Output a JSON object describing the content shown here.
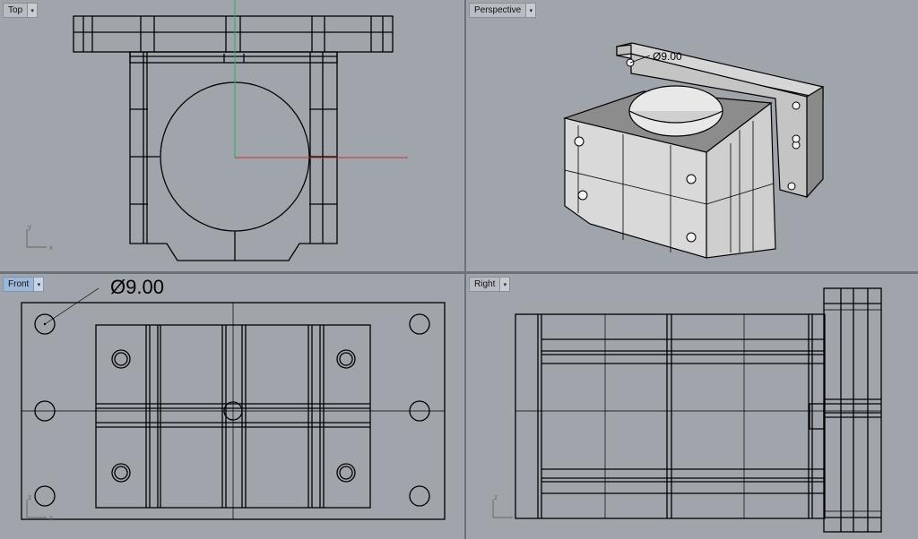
{
  "viewports": {
    "top": {
      "label": "Top",
      "axis_y": "y",
      "axis_x": "x"
    },
    "perspective": {
      "label": "Perspective",
      "dim_text": "Ø9.00"
    },
    "front": {
      "label": "Front",
      "dim_text": "Ø9.00",
      "axis_y": "z",
      "axis_x": "x"
    },
    "right": {
      "label": "Right",
      "axis_y": "z"
    }
  },
  "colors": {
    "background": "#a0a4ab",
    "linework": "#000000",
    "x_axis": "#c0392b",
    "y_axis": "#27ae60",
    "active_tab": "#9fb7d6"
  },
  "icons": {
    "viewport_menu": "chevron-down-icon"
  }
}
